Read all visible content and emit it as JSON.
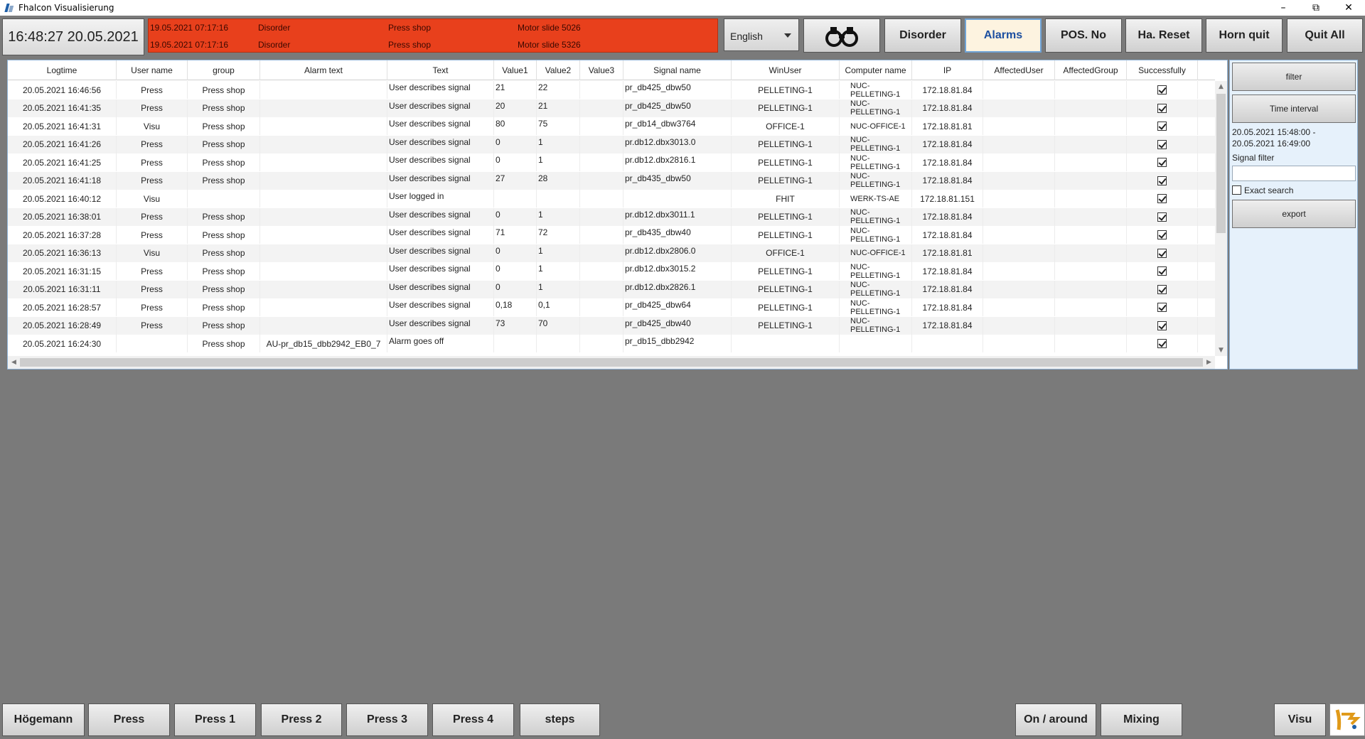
{
  "window": {
    "title": "Fhalcon Visualisierung"
  },
  "toolbar": {
    "clock": "16:48:27  20.05.2021",
    "alarms": [
      {
        "time": "19.05.2021  07:17:16",
        "type": "Disorder",
        "group": "Press shop",
        "text": "Motor slide 5026"
      },
      {
        "time": "19.05.2021  07:17:16",
        "type": "Disorder",
        "group": "Press shop",
        "text": "Motor slide 5326"
      }
    ],
    "language": "English",
    "buttons": {
      "disorder": "Disorder",
      "alarms": "Alarms",
      "pos_no": "POS. No",
      "ha_reset": "Ha. Reset",
      "horn_quit": "Horn quit",
      "quit_all": "Quit All"
    },
    "colors": {
      "alarm_banner": "#e8401c",
      "active_button_bg": "#fdf3e0"
    }
  },
  "table": {
    "columns": [
      "Logtime",
      "User name",
      "group",
      "Alarm text",
      "Text",
      "Value1",
      "Value2",
      "Value3",
      "Signal name",
      "WinUser",
      "Computer name",
      "IP",
      "AffectedUser",
      "AffectedGroup",
      "Successfully"
    ],
    "rows": [
      {
        "logtime": "20.05.2021  16:46:56",
        "user": "Press",
        "group": "Press shop",
        "alarm_text": "",
        "text": "User describes signal",
        "v1": "21",
        "v2": "22",
        "v3": "",
        "signal": "pr_db425_dbw50",
        "winuser": "PELLETING-1",
        "computer1": "NUC-",
        "computer2": "PELLETING-1",
        "ip": "172.18.81.84",
        "success": true
      },
      {
        "logtime": "20.05.2021  16:41:35",
        "user": "Press",
        "group": "Press shop",
        "alarm_text": "",
        "text": "User describes signal",
        "v1": "20",
        "v2": "21",
        "v3": "",
        "signal": "pr_db425_dbw50",
        "winuser": "PELLETING-1",
        "computer1": "NUC-",
        "computer2": "PELLETING-1",
        "ip": "172.18.81.84",
        "success": true
      },
      {
        "logtime": "20.05.2021  16:41:31",
        "user": "Visu",
        "group": "Press shop",
        "alarm_text": "",
        "text": "User describes signal",
        "v1": "80",
        "v2": "75",
        "v3": "",
        "signal": "pr_db14_dbw3764",
        "winuser": "OFFICE-1",
        "computer1": "NUC-OFFICE-1",
        "computer2": "",
        "ip": "172.18.81.81",
        "success": true
      },
      {
        "logtime": "20.05.2021  16:41:26",
        "user": "Press",
        "group": "Press shop",
        "alarm_text": "",
        "text": "User describes signal",
        "v1": "0",
        "v2": "1",
        "v3": "",
        "signal": "pr.db12.dbx3013.0",
        "winuser": "PELLETING-1",
        "computer1": "NUC-",
        "computer2": "PELLETING-1",
        "ip": "172.18.81.84",
        "success": true
      },
      {
        "logtime": "20.05.2021  16:41:25",
        "user": "Press",
        "group": "Press shop",
        "alarm_text": "",
        "text": "User describes signal",
        "v1": "0",
        "v2": "1",
        "v3": "",
        "signal": "pr.db12.dbx2816.1",
        "winuser": "PELLETING-1",
        "computer1": "NUC-",
        "computer2": "PELLETING-1",
        "ip": "172.18.81.84",
        "success": true
      },
      {
        "logtime": "20.05.2021  16:41:18",
        "user": "Press",
        "group": "Press shop",
        "alarm_text": "",
        "text": "User describes signal",
        "v1": "27",
        "v2": "28",
        "v3": "",
        "signal": "pr_db435_dbw50",
        "winuser": "PELLETING-1",
        "computer1": "NUC-",
        "computer2": "PELLETING-1",
        "ip": "172.18.81.84",
        "success": true
      },
      {
        "logtime": "20.05.2021  16:40:12",
        "user": "Visu",
        "group": "",
        "alarm_text": "",
        "text": "User logged in",
        "v1": "",
        "v2": "",
        "v3": "",
        "signal": "",
        "winuser": "FHIT",
        "computer1": "WERK-TS-AE",
        "computer2": "",
        "ip": "172.18.81.151",
        "success": true
      },
      {
        "logtime": "20.05.2021  16:38:01",
        "user": "Press",
        "group": "Press shop",
        "alarm_text": "",
        "text": "User describes signal",
        "v1": "0",
        "v2": "1",
        "v3": "",
        "signal": "pr.db12.dbx3011.1",
        "winuser": "PELLETING-1",
        "computer1": "NUC-",
        "computer2": "PELLETING-1",
        "ip": "172.18.81.84",
        "success": true
      },
      {
        "logtime": "20.05.2021  16:37:28",
        "user": "Press",
        "group": "Press shop",
        "alarm_text": "",
        "text": "User describes signal",
        "v1": "71",
        "v2": "72",
        "v3": "",
        "signal": "pr_db435_dbw40",
        "winuser": "PELLETING-1",
        "computer1": "NUC-",
        "computer2": "PELLETING-1",
        "ip": "172.18.81.84",
        "success": true
      },
      {
        "logtime": "20.05.2021  16:36:13",
        "user": "Visu",
        "group": "Press shop",
        "alarm_text": "",
        "text": "User describes signal",
        "v1": "0",
        "v2": "1",
        "v3": "",
        "signal": "pr.db12.dbx2806.0",
        "winuser": "OFFICE-1",
        "computer1": "NUC-OFFICE-1",
        "computer2": "",
        "ip": "172.18.81.81",
        "success": true
      },
      {
        "logtime": "20.05.2021  16:31:15",
        "user": "Press",
        "group": "Press shop",
        "alarm_text": "",
        "text": "User describes signal",
        "v1": "0",
        "v2": "1",
        "v3": "",
        "signal": "pr.db12.dbx3015.2",
        "winuser": "PELLETING-1",
        "computer1": "NUC-",
        "computer2": "PELLETING-1",
        "ip": "172.18.81.84",
        "success": true
      },
      {
        "logtime": "20.05.2021  16:31:11",
        "user": "Press",
        "group": "Press shop",
        "alarm_text": "",
        "text": "User describes signal",
        "v1": "0",
        "v2": "1",
        "v3": "",
        "signal": "pr.db12.dbx2826.1",
        "winuser": "PELLETING-1",
        "computer1": "NUC-",
        "computer2": "PELLETING-1",
        "ip": "172.18.81.84",
        "success": true
      },
      {
        "logtime": "20.05.2021  16:28:57",
        "user": "Press",
        "group": "Press shop",
        "alarm_text": "",
        "text": "User describes signal",
        "v1": "0,18",
        "v2": "0,1",
        "v3": "",
        "signal": "pr_db425_dbw64",
        "winuser": "PELLETING-1",
        "computer1": "NUC-",
        "computer2": "PELLETING-1",
        "ip": "172.18.81.84",
        "success": true
      },
      {
        "logtime": "20.05.2021  16:28:49",
        "user": "Press",
        "group": "Press shop",
        "alarm_text": "",
        "text": "User describes signal",
        "v1": "73",
        "v2": "70",
        "v3": "",
        "signal": "pr_db425_dbw40",
        "winuser": "PELLETING-1",
        "computer1": "NUC-",
        "computer2": "PELLETING-1",
        "ip": "172.18.81.84",
        "success": true
      },
      {
        "logtime": "20.05.2021  16:24:30",
        "user": "",
        "group": "Press shop",
        "alarm_text": "AU-pr_db15_dbb2942_EB0_7",
        "text": "Alarm goes off",
        "v1": "",
        "v2": "",
        "v3": "",
        "signal": "pr_db15_dbb2942",
        "winuser": "",
        "computer1": "",
        "computer2": "",
        "ip": "",
        "success": true
      }
    ]
  },
  "filter_panel": {
    "filter_button": "filter",
    "time_interval_button": "Time interval",
    "interval_start": "20.05.2021 15:48:00 -",
    "interval_end": "20.05.2021 16:49:00",
    "signal_filter_label": "Signal filter",
    "signal_filter_value": "",
    "exact_search_label": "Exact search",
    "exact_search_checked": false,
    "export_button": "export"
  },
  "bottom_nav": {
    "left": [
      "Högemann",
      "Press",
      "Press 1",
      "Press 2",
      "Press 3",
      "Press 4",
      "steps"
    ],
    "right": [
      "On / around",
      "Mixing",
      "Visu"
    ]
  }
}
